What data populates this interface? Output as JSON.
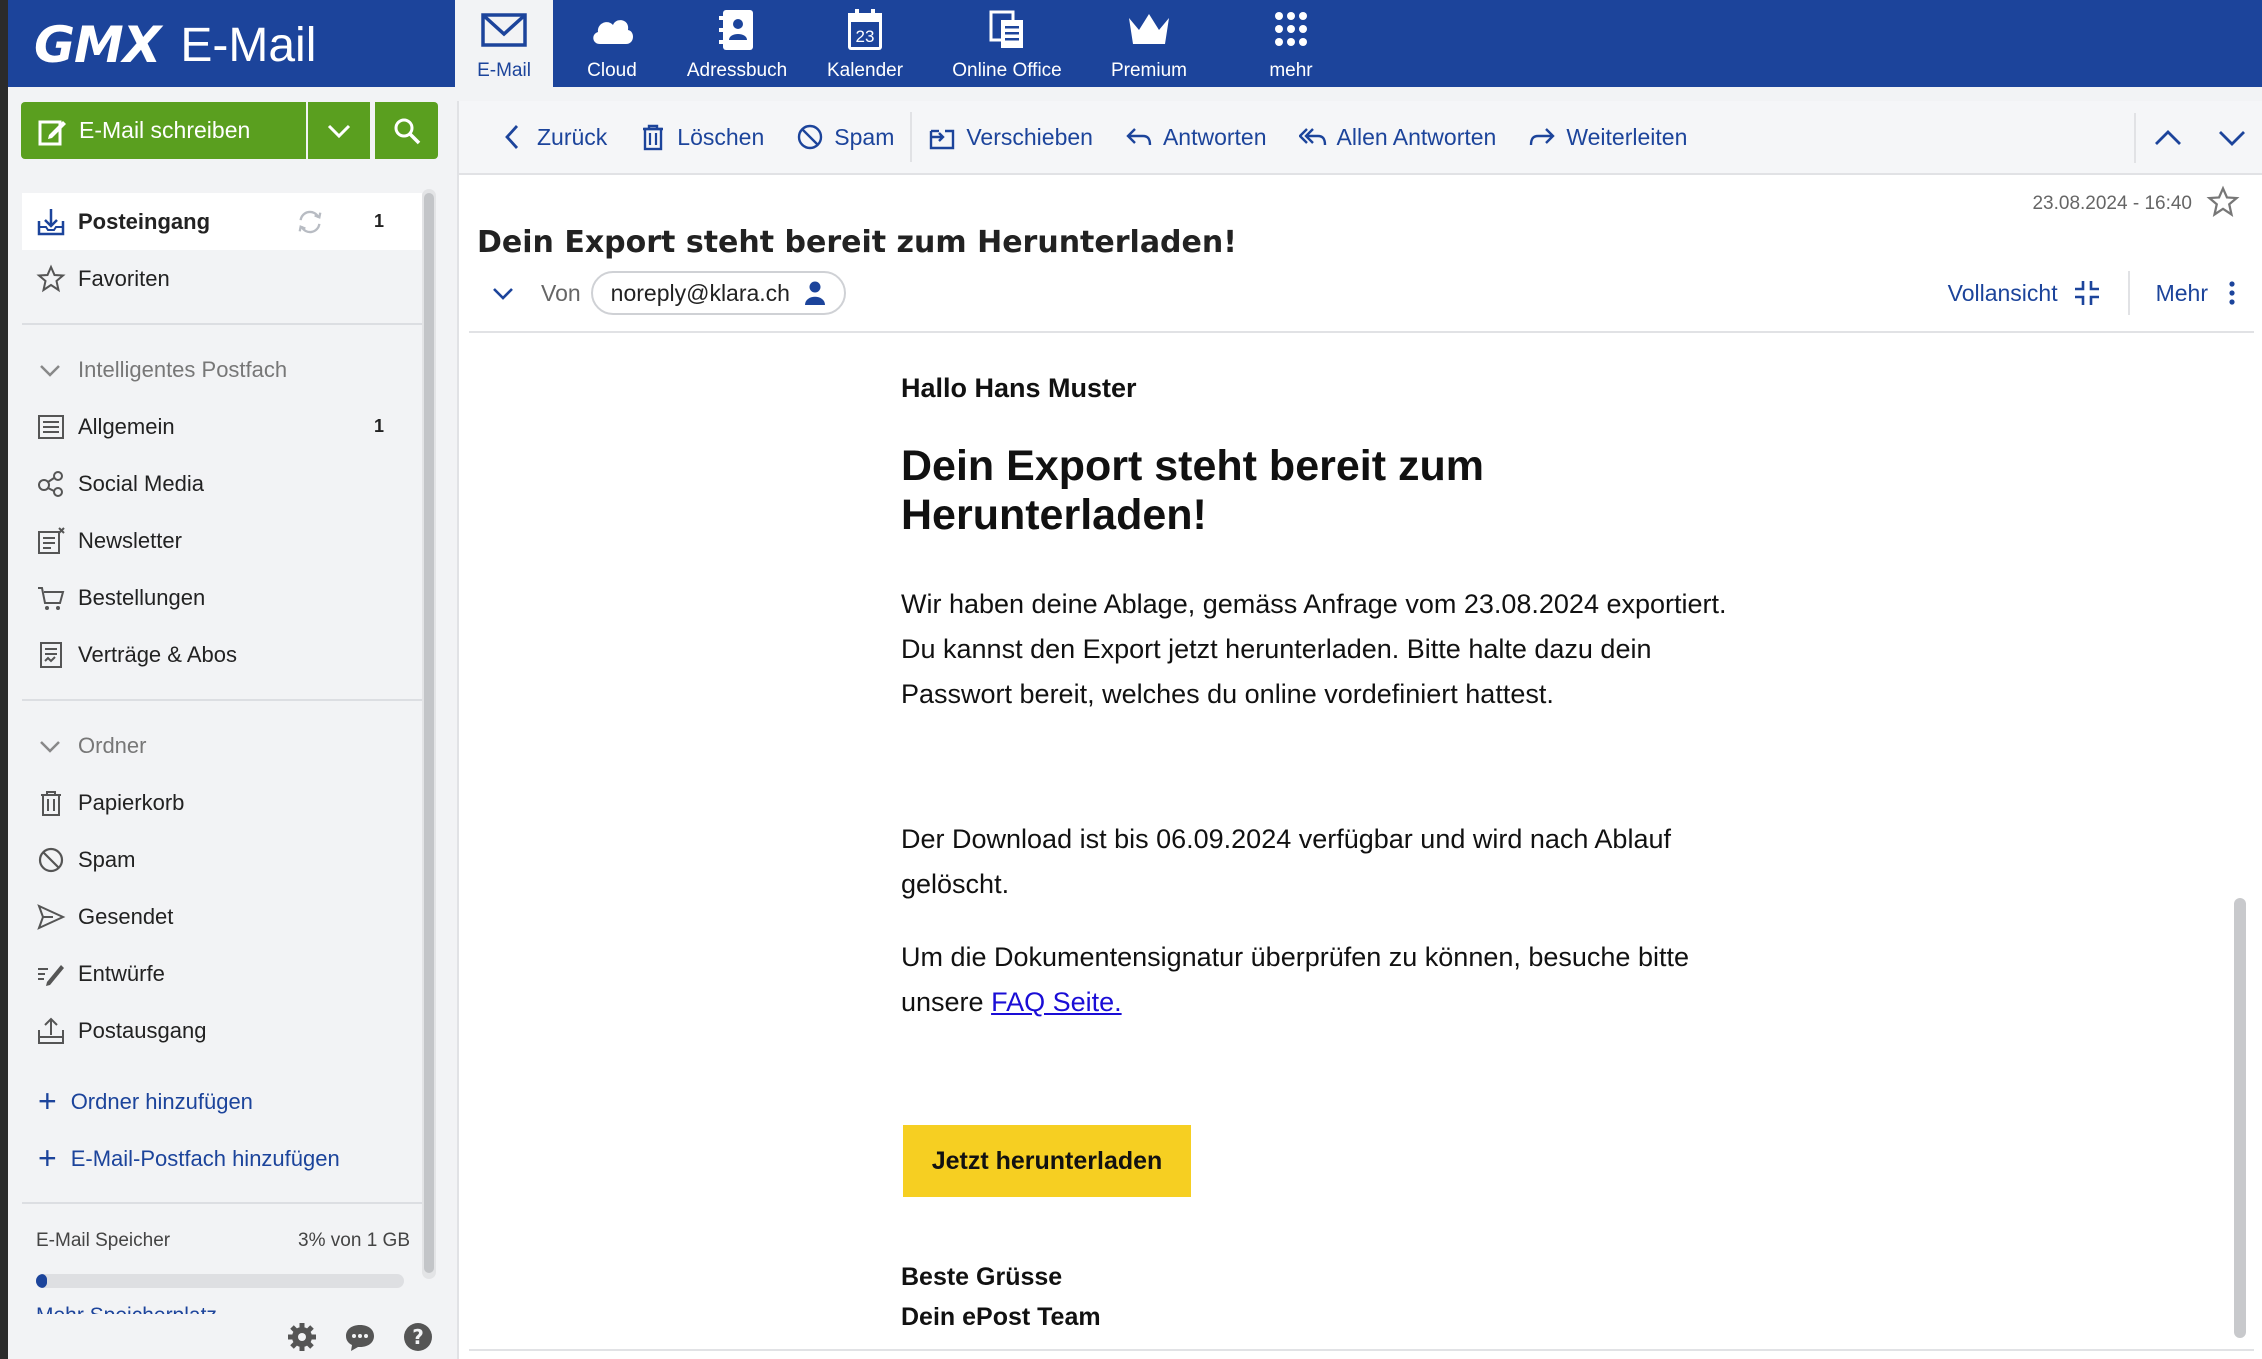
{
  "header": {
    "brand": "GMX",
    "product": "E-Mail",
    "nav": [
      {
        "label": "E-Mail",
        "icon": "mail-icon",
        "active": true
      },
      {
        "label": "Cloud",
        "icon": "cloud-icon"
      },
      {
        "label": "Adressbuch",
        "icon": "addressbook-icon"
      },
      {
        "label": "Kalender",
        "icon": "calendar-icon",
        "day": "23"
      },
      {
        "label": "Online Office",
        "icon": "office-icon"
      },
      {
        "label": "Premium",
        "icon": "crown-icon"
      },
      {
        "label": "mehr",
        "icon": "grid-icon"
      }
    ]
  },
  "sidebar": {
    "compose_label": "E-Mail schreiben",
    "inbox": {
      "label": "Posteingang",
      "count": "1"
    },
    "favorites": {
      "label": "Favoriten"
    },
    "smart_title": "Intelligentes Postfach",
    "smart_items": [
      {
        "label": "Allgemein",
        "count": "1"
      },
      {
        "label": "Social Media"
      },
      {
        "label": "Newsletter"
      },
      {
        "label": "Bestellungen"
      },
      {
        "label": "Verträge & Abos"
      }
    ],
    "folders_title": "Ordner",
    "folders": [
      {
        "label": "Papierkorb"
      },
      {
        "label": "Spam"
      },
      {
        "label": "Gesendet"
      },
      {
        "label": "Entwürfe"
      },
      {
        "label": "Postausgang"
      }
    ],
    "add_folder": "Ordner hinzufügen",
    "add_mailbox": "E-Mail-Postfach hinzufügen",
    "storage": {
      "label": "E-Mail Speicher",
      "value": "3% von 1 GB",
      "percent": 3,
      "more": "Mehr Speicherplatz"
    }
  },
  "toolbar": {
    "back": "Zurück",
    "delete": "Löschen",
    "spam": "Spam",
    "move": "Verschieben",
    "reply": "Antworten",
    "reply_all": "Allen Antworten",
    "forward": "Weiterleiten"
  },
  "message": {
    "date": "23.08.2024 - 16:40",
    "subject": "Dein Export steht bereit zum Herunterladen!",
    "from_label": "Von",
    "from": "noreply@klara.ch",
    "full_view": "Vollansicht",
    "more": "Mehr",
    "body": {
      "greeting": "Hallo Hans Muster",
      "headline": "Dein Export steht bereit zum Herunterladen!",
      "p1_l1": "Wir haben deine Ablage, gemäss Anfrage vom 23.08.2024 exportiert.",
      "p1_l2": "Du kannst den Export jetzt herunterladen. Bitte halte dazu dein",
      "p1_l3": "Passwort bereit, welches du online vordefiniert hattest.",
      "p2_l1": "Der Download ist bis 06.09.2024 verfügbar und wird nach Ablauf",
      "p2_l2": "gelöscht.",
      "p3_l1": "Um die Dokumentensignatur überprüfen zu können, besuche bitte",
      "p3_l2_prefix": "unsere ",
      "p3_link": "FAQ Seite.",
      "button": "Jetzt herunterladen",
      "sig_l1": "Beste Grüsse",
      "sig_l2": "Dein ePost Team"
    }
  },
  "colors": {
    "brand_blue": "#1c449b",
    "compose_green": "#5a9f1f",
    "cta_yellow": "#f6cf22"
  }
}
